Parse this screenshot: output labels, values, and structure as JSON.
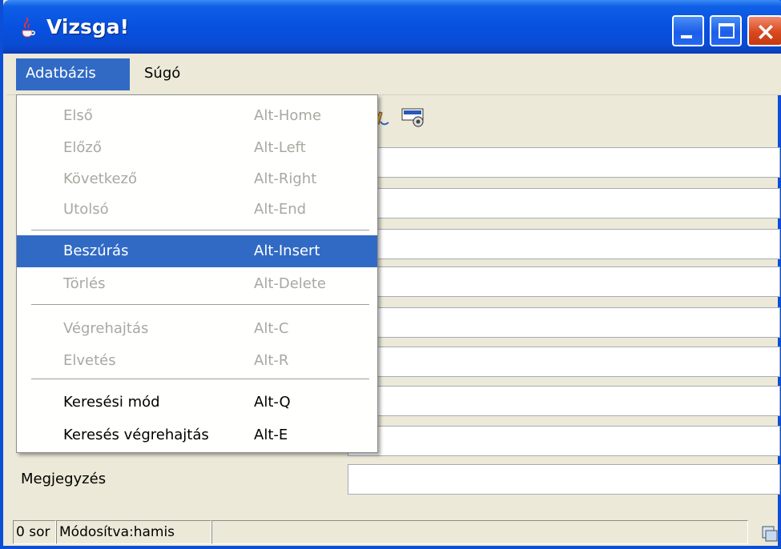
{
  "window": {
    "title": "Vizsga!",
    "icon": "java-cup-icon",
    "accent": "#0751e0"
  },
  "menubar": {
    "items": [
      {
        "label": "Adatbázis"
      },
      {
        "label": "Súgó"
      }
    ]
  },
  "dropdown": {
    "items": [
      {
        "label": "Első",
        "accelerator": "Alt-Home",
        "enabled": false
      },
      {
        "label": "Előző",
        "accelerator": "Alt-Left",
        "enabled": false
      },
      {
        "label": "Következő",
        "accelerator": "Alt-Right",
        "enabled": false
      },
      {
        "label": "Utolsó",
        "accelerator": "Alt-End",
        "enabled": false
      },
      {
        "label": "Beszúrás",
        "accelerator": "Alt-Insert",
        "enabled": true,
        "highlighted": true
      },
      {
        "label": "Törlés",
        "accelerator": "Alt-Delete",
        "enabled": false
      },
      {
        "label": "Végrehajtás",
        "accelerator": "Alt-C",
        "enabled": false
      },
      {
        "label": "Elvetés",
        "accelerator": "Alt-R",
        "enabled": false
      },
      {
        "label": "Keresési mód",
        "accelerator": "Alt-Q",
        "enabled": true
      },
      {
        "label": "Keresés végrehajtás",
        "accelerator": "Alt-E",
        "enabled": true
      }
    ],
    "highlight_color": "#316ac5"
  },
  "form": {
    "last_label": "Megjegyzés"
  },
  "statusbar": {
    "rows": "0 sor",
    "modified": "Módosítva:hamis"
  }
}
